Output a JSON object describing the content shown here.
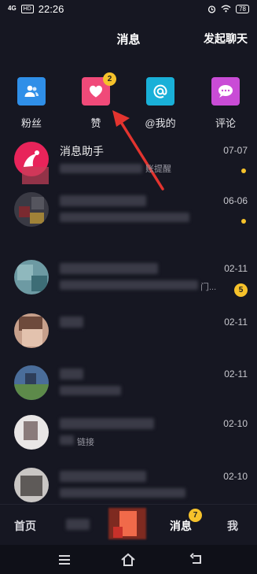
{
  "status_bar": {
    "signal": "4G",
    "hd": "HD",
    "time": "22:26",
    "battery": "78"
  },
  "header": {
    "title": "消息",
    "start_chat": "发起聊天"
  },
  "categories": [
    {
      "label": "粉丝",
      "icon": "fans-icon",
      "color": "#2f8fe8"
    },
    {
      "label": "赞",
      "icon": "heart-icon",
      "color": "#f04a79",
      "badge": "2"
    },
    {
      "label": "@我的",
      "icon": "at-icon",
      "color": "#19b0d8"
    },
    {
      "label": "评论",
      "icon": "comment-icon",
      "color": "#c94cd6"
    }
  ],
  "messages": [
    {
      "title": "消息助手",
      "subtitle": "账提醒",
      "time": "07-07",
      "indicator": "dot"
    },
    {
      "title": "",
      "subtitle": "",
      "time": "06-06",
      "indicator": "dot"
    },
    {
      "title": "",
      "subtitle": "门...",
      "time": "02-11",
      "indicator": "count",
      "count": "5"
    },
    {
      "title": "",
      "subtitle": "",
      "time": "02-11",
      "indicator": ""
    },
    {
      "title": "",
      "subtitle": "",
      "time": "02-11",
      "indicator": ""
    },
    {
      "title": "",
      "subtitle": "链接",
      "time": "02-10",
      "indicator": ""
    },
    {
      "title": "",
      "subtitle": "",
      "time": "02-10",
      "indicator": ""
    }
  ],
  "tabbar": {
    "home": "首页",
    "friends": "",
    "messages": "消息",
    "messages_badge": "7",
    "me": "我"
  },
  "colors": {
    "background": "#161722",
    "badge": "#f6c22b",
    "arrow": "#e3342f"
  }
}
